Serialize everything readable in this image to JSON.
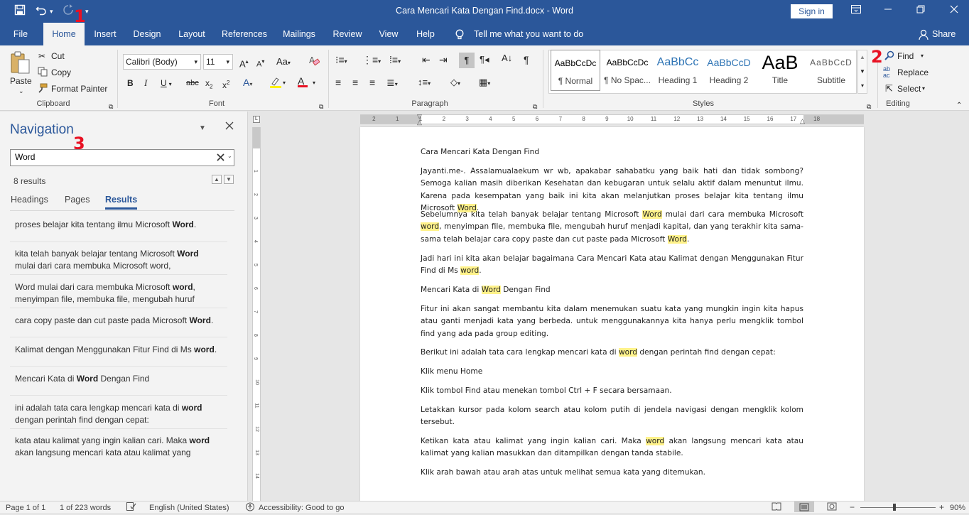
{
  "window": {
    "title": "Cara Mencari Kata Dengan Find.docx  -  Word",
    "sign_in": "Sign in"
  },
  "tabs": [
    "File",
    "Home",
    "Insert",
    "Design",
    "Layout",
    "References",
    "Mailings",
    "Review",
    "View",
    "Help"
  ],
  "tell_me": "Tell me what you want to do",
  "share": "Share",
  "ribbon": {
    "clipboard": {
      "label": "Clipboard",
      "paste": "Paste",
      "cut": "Cut",
      "copy": "Copy",
      "format_painter": "Format Painter"
    },
    "font": {
      "label": "Font",
      "font_name": "Calibri (Body)",
      "font_size": "11"
    },
    "paragraph": {
      "label": "Paragraph"
    },
    "styles": {
      "label": "Styles",
      "items": [
        {
          "preview": "AaBbCcDc",
          "name": "¶ Normal"
        },
        {
          "preview": "AaBbCcDc",
          "name": "¶ No Spac..."
        },
        {
          "preview": "AaBbCc",
          "name": "Heading 1"
        },
        {
          "preview": "AaBbCcD",
          "name": "Heading 2"
        },
        {
          "preview": "AaB",
          "name": "Title"
        },
        {
          "preview": "AaBbCcD",
          "name": "Subtitle"
        }
      ]
    },
    "editing": {
      "label": "Editing",
      "find": "Find",
      "replace": "Replace",
      "select": "Select"
    }
  },
  "markers": {
    "m1": "1",
    "m2": "2",
    "m3": "3"
  },
  "navigation": {
    "title": "Navigation",
    "search_value": "Word",
    "results_count": "8 results",
    "tabs": [
      "Headings",
      "Pages",
      "Results"
    ],
    "results": [
      {
        "before": "proses belajar kita tentang ilmu Microsoft ",
        "match": "Word",
        "after": "."
      },
      {
        "before": "kita telah banyak belajar tentang Microsoft ",
        "match": "Word",
        "after": " mulai dari cara membuka Microsoft word,"
      },
      {
        "before": "Word mulai dari cara membuka Microsoft ",
        "match": "word",
        "after": ", menyimpan file, membuka file, mengubah huruf"
      },
      {
        "before": "cara copy paste dan cut paste pada Microsoft ",
        "match": "Word",
        "after": "."
      },
      {
        "before": "Kalimat dengan Menggunakan Fitur Find di Ms ",
        "match": "word",
        "after": "."
      },
      {
        "before": "Mencari Kata di ",
        "match": "Word",
        "after": " Dengan Find"
      },
      {
        "before": "ini adalah tata cara lengkap mencari kata di ",
        "match": "word",
        "after": " dengan perintah find dengan cepat:"
      },
      {
        "before": "kata atau kalimat yang ingin kalian cari. Maka ",
        "match": "word",
        "after": " akan langsung mencari kata atau kalimat yang"
      }
    ]
  },
  "ruler_numbers": [
    "2",
    "1",
    "1",
    "2",
    "3",
    "4",
    "5",
    "6",
    "7",
    "8",
    "9",
    "10",
    "11",
    "12",
    "13",
    "14",
    "15",
    "16",
    "17",
    "18"
  ],
  "vruler_numbers": [
    "1",
    "2",
    "3",
    "4",
    "5",
    "6",
    "7",
    "8",
    "9",
    "10",
    "11",
    "12",
    "13",
    "14"
  ],
  "document": {
    "paragraphs": [
      "Cara Mencari Kata Dengan Find",
      "Jayanti.me-. Assalamualaekum wr wb, apakabar sahabatku yang baik hati dan tidak sombong? Semoga kalian masih diberikan Kesehatan dan kebugaran untuk selalu aktif dalam menuntut ilmu. Karena pada kesempatan yang baik ini kita akan melanjutkan proses belajar kita tentang ilmu Microsoft [Word].",
      "Sebelumnya kita telah banyak belajar tentang Microsoft [Word] mulai dari cara membuka Microsoft [word], menyimpan file, membuka file, mengubah huruf menjadi kapital, dan yang terakhir kita sama-sama telah belajar cara copy paste dan cut paste pada Microsoft [Word].",
      "Jadi hari ini kita akan belajar bagaimana Cara Mencari Kata atau Kalimat dengan Menggunakan Fitur Find di Ms [word].",
      "Mencari Kata di [Word] Dengan Find",
      "Fitur ini akan sangat membantu kita dalam menemukan suatu kata yang mungkin ingin kita hapus atau ganti menjadi kata yang berbeda. untuk menggunakannya kita hanya perlu mengklik tombol find yang ada pada group editing.",
      "Berikut ini adalah tata cara lengkap mencari kata di [word] dengan perintah find dengan cepat:",
      "Klik menu Home",
      "Klik tombol Find atau menekan tombol Ctrl + F secara bersamaan.",
      "Letakkan kursor pada kolom search atau kolom putih di jendela navigasi dengan mengklik kolom tersebut.",
      "Ketikan kata atau kalimat yang ingin kalian cari. Maka [word] akan langsung mencari kata atau kalimat yang kalian masukkan dan ditampilkan dengan tanda stabile.",
      "Klik arah bawah atau arah atas untuk melihat semua kata yang ditemukan."
    ]
  },
  "status": {
    "page": "Page 1 of 1",
    "words": "1 of 223 words",
    "language": "English (United States)",
    "accessibility": "Accessibility: Good to go",
    "zoom": "90%"
  },
  "colors": {
    "accent": "#2b579a",
    "highlight": "#fff28a",
    "marker": "#e81123"
  }
}
